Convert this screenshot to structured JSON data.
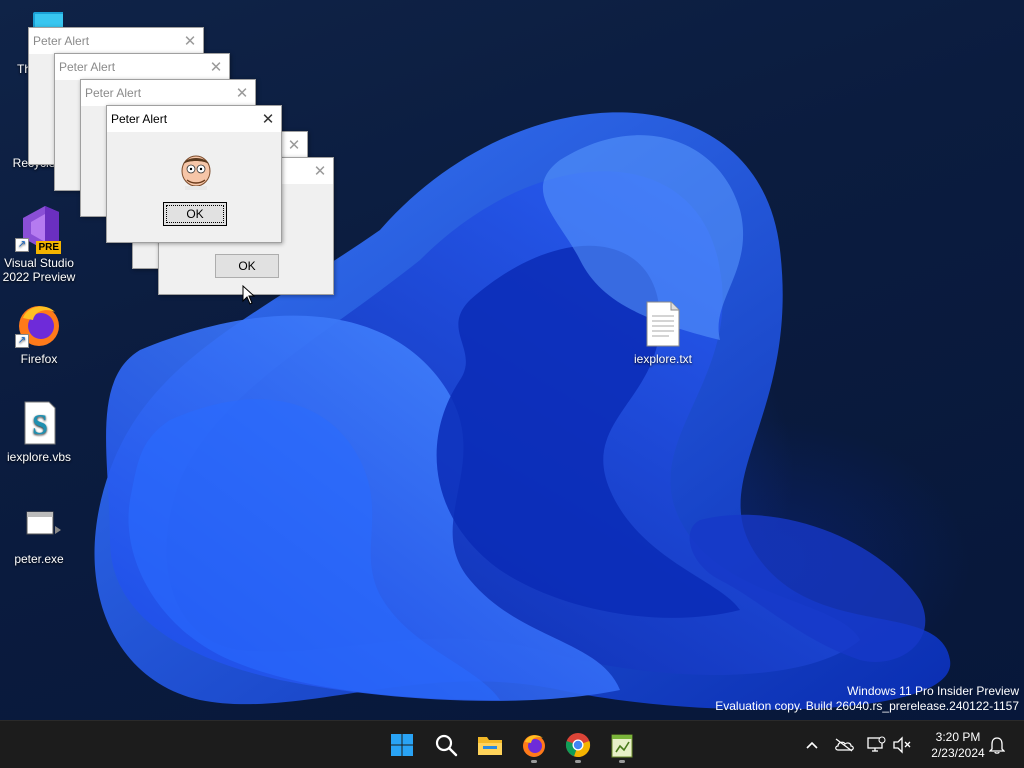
{
  "desktop": {
    "icons": [
      {
        "label": "Th",
        "icon": "this-pc-icon"
      },
      {
        "label": "Recycle",
        "icon": "recycle-bin-icon"
      },
      {
        "label": "Visual Studio 2022 Preview",
        "badge": "PRE",
        "icon": "visual-studio-icon"
      },
      {
        "label": "Firefox",
        "icon": "firefox-icon"
      },
      {
        "label": "iexplore.vbs",
        "icon": "vbs-script-icon"
      },
      {
        "label": "peter.exe",
        "icon": "exe-icon"
      },
      {
        "label": "iexplore.txt",
        "icon": "text-file-icon"
      }
    ]
  },
  "dialogs": {
    "title": "Peter Alert",
    "ok_label": "OK",
    "close_glyph": "✕"
  },
  "watermark": {
    "line1": "Windows 11 Pro Insider Preview",
    "line2": "Evaluation copy. Build 26040.rs_prerelease.240122-1157"
  },
  "taskbar": {
    "apps": [
      "start-icon",
      "search-icon",
      "file-explorer-icon",
      "firefox-icon",
      "chrome-icon",
      "notepad-icon"
    ],
    "tray": [
      "chevron-up-icon",
      "onedrive-icon",
      "network-icon",
      "volume-muted-icon",
      "notification-bell-icon"
    ],
    "time": "3:20 PM",
    "date": "2/23/2024"
  },
  "colors": {
    "accent": "#1f5cff",
    "taskbar": "#1c1c1c",
    "dialog_bg": "#f0f0f0"
  }
}
